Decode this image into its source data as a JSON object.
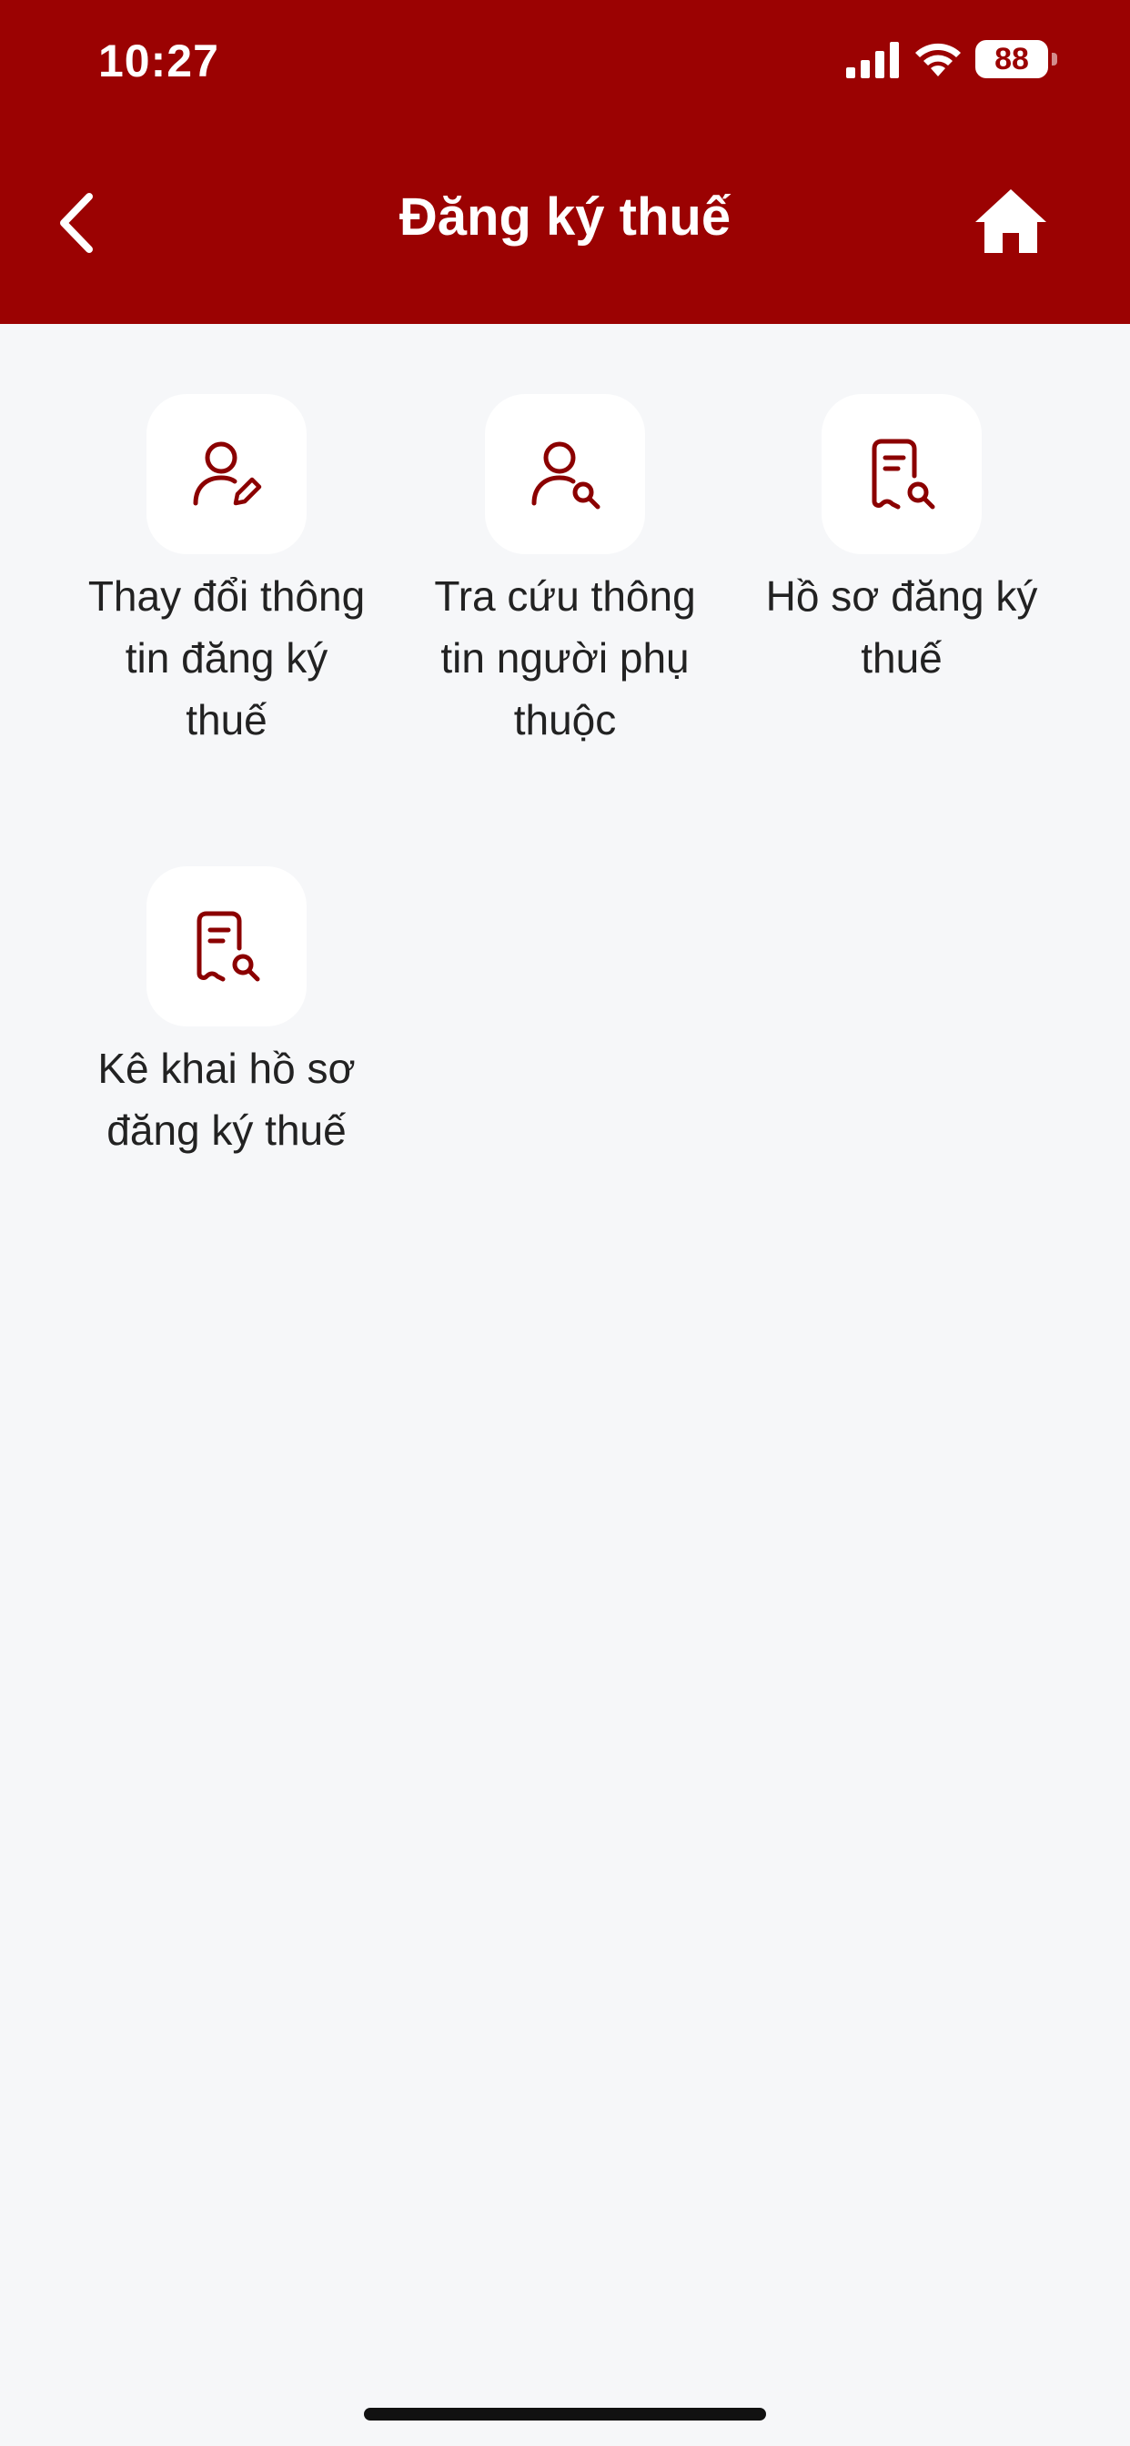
{
  "status_bar": {
    "time": "10:27",
    "battery": "88"
  },
  "header": {
    "title": "Đăng ký thuế",
    "back_icon": "chevron-left-icon",
    "home_icon": "home-icon",
    "background": "#9b0202"
  },
  "menu": {
    "items": [
      {
        "label": "Thay đổi thông tin đăng ký thuế",
        "icon": "user-edit-icon"
      },
      {
        "label": "Tra cứu thông tin người phụ thuộc",
        "icon": "user-search-icon"
      },
      {
        "label": "Hồ sơ đăng ký thuế",
        "icon": "document-search-icon"
      },
      {
        "label": "Kê khai hồ sơ đăng ký thuế",
        "icon": "document-search-icon"
      }
    ],
    "icon_color": "#8b0000"
  }
}
